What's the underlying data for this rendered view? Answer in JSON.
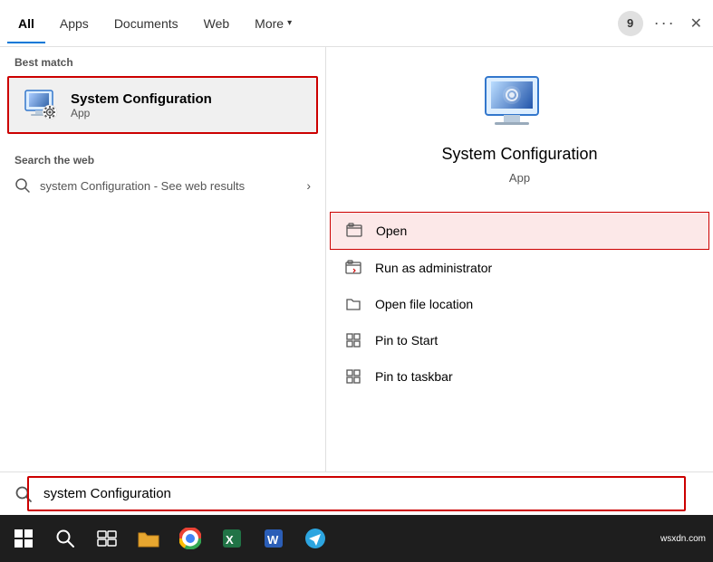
{
  "tabs": {
    "items": [
      {
        "label": "All",
        "active": true
      },
      {
        "label": "Apps",
        "active": false
      },
      {
        "label": "Documents",
        "active": false
      },
      {
        "label": "Web",
        "active": false
      },
      {
        "label": "More",
        "active": false
      }
    ],
    "badge": "9",
    "dots": "···",
    "close": "✕"
  },
  "left": {
    "best_match_label": "Best match",
    "app_title": "System Configuration",
    "app_sub": "App",
    "web_section_label": "Search the web",
    "web_item_text": "system Configuration",
    "web_item_suffix": " - See web results"
  },
  "right": {
    "app_title": "System Configuration",
    "app_sub": "App"
  },
  "context_menu": {
    "items": [
      {
        "label": "Open",
        "highlighted": true
      },
      {
        "label": "Run as administrator",
        "highlighted": false
      },
      {
        "label": "Open file location",
        "highlighted": false
      },
      {
        "label": "Pin to Start",
        "highlighted": false
      },
      {
        "label": "Pin to taskbar",
        "highlighted": false
      }
    ]
  },
  "search_bar": {
    "value": "system Configuration",
    "placeholder": "system Configuration"
  },
  "taskbar": {
    "watermark": "wsxdn.com"
  }
}
